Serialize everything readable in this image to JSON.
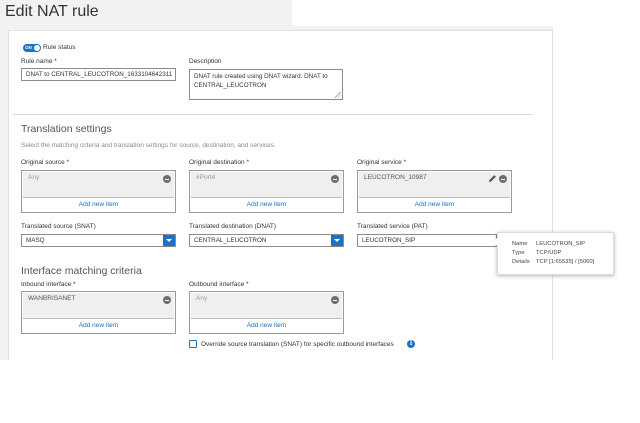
{
  "page": {
    "title": "Edit NAT rule"
  },
  "rule": {
    "status_toggle_text": "ON",
    "status_label": "Rule status",
    "name_label": "Rule name *",
    "name_value": "DNAT to CENTRAL_LEUCOTRON_1633104642311",
    "description_label": "Description",
    "description_value": "DNAT rule created using DNAT wizard. DNAT to CENTRAL_LEUCOTRON"
  },
  "translation": {
    "title": "Translation settings",
    "subtitle": "Select the matching criteria and translation settings for source, destination, and services.",
    "original_source": {
      "label": "Original source *",
      "item": "Any",
      "add": "Add new item"
    },
    "original_destination": {
      "label": "Original destination *",
      "item": "#Port4",
      "add": "Add new item"
    },
    "original_service": {
      "label": "Original service *",
      "item": "LEUCOTRON_10987",
      "add": "Add new item"
    },
    "translated_source": {
      "label": "Translated source (SNAT)",
      "value": "MASQ"
    },
    "translated_destination": {
      "label": "Translated destination (DNAT)",
      "value": "CENTRAL_LEUCOTRON"
    },
    "translated_service": {
      "label": "Translated service (PAT)",
      "value": "LEUCOTRON_SIP"
    }
  },
  "interface": {
    "title": "Interface matching criteria",
    "inbound": {
      "label": "Inbound interface *",
      "item": "WANBRISANET",
      "add": "Add new item"
    },
    "outbound": {
      "label": "Outbound interface *",
      "item": "Any",
      "add": "Add new item"
    },
    "override_label": "Override source translation (SNAT) for specific outbound interfaces"
  },
  "tooltip": {
    "name_key": "Name",
    "name_value": "LEUCOTRON_SIP",
    "type_key": "Type",
    "type_value": "TCP/UDP",
    "details_key": "Details",
    "details_value": "TCP [1:65535] / [5060]"
  },
  "colors": {
    "accent": "#1a73c7",
    "link": "#1a73c7",
    "page_bg": "#f2f2f2"
  },
  "icons": {
    "remove": "minus-circle-icon",
    "edit": "pencil-icon",
    "info": "info-icon",
    "dropdown": "chevron-down-icon"
  }
}
